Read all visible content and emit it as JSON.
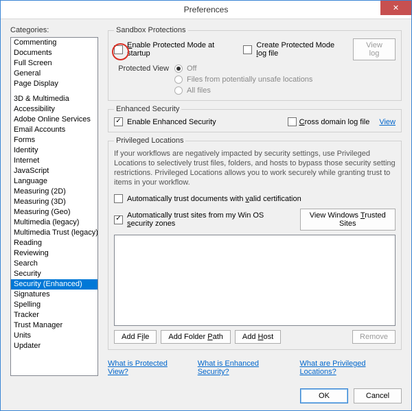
{
  "window": {
    "title": "Preferences"
  },
  "left": {
    "label": "Categories:",
    "group1": [
      "Commenting",
      "Documents",
      "Full Screen",
      "General",
      "Page Display"
    ],
    "group2": [
      "3D & Multimedia",
      "Accessibility",
      "Adobe Online Services",
      "Email Accounts",
      "Forms",
      "Identity",
      "Internet",
      "JavaScript",
      "Language",
      "Measuring (2D)",
      "Measuring (3D)",
      "Measuring (Geo)",
      "Multimedia (legacy)",
      "Multimedia Trust (legacy)",
      "Reading",
      "Reviewing",
      "Search",
      "Security",
      "Security (Enhanced)",
      "Signatures",
      "Spelling",
      "Tracker",
      "Trust Manager",
      "Units",
      "Updater"
    ],
    "selected": "Security (Enhanced)"
  },
  "sandbox": {
    "legend": "Sandbox Protections",
    "enable_protected": "Enable Protected Mode at startup",
    "create_log": "Create Protected Mode log file",
    "view_log": "View log",
    "protected_view_label": "Protected View",
    "opt_off": "Off",
    "opt_unsafe": "Files from potentially unsafe locations",
    "opt_all": "All files"
  },
  "enhanced": {
    "legend": "Enhanced Security",
    "enable": "Enable Enhanced Security",
    "cross_domain": "Cross domain log file",
    "view": "View"
  },
  "priv": {
    "legend": "Privileged Locations",
    "help": "If your workflows are negatively impacted by security settings, use Privileged Locations to selectively trust files, folders, and hosts to bypass those security setting restrictions. Privileged Locations allows you to work securely while granting trust to items in your workflow.",
    "auto_valid": "Automatically trust documents with valid certification",
    "auto_winos": "Automatically trust sites from my Win OS security zones",
    "view_trusted": "View Windows Trusted Sites",
    "add_file": "Add File",
    "add_folder": "Add Folder Path",
    "add_host": "Add Host",
    "remove": "Remove"
  },
  "links": {
    "protected": "What is Protected View?",
    "enhanced": "What is Enhanced Security?",
    "privileged": "What are Privileged Locations?"
  },
  "footer": {
    "ok": "OK",
    "cancel": "Cancel"
  }
}
